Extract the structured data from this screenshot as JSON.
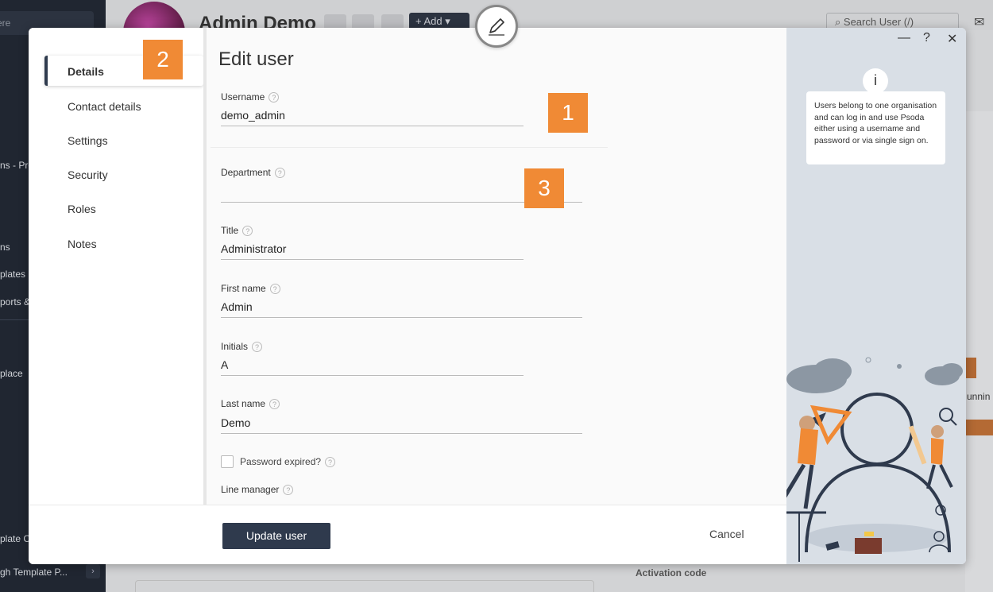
{
  "background": {
    "sidebar": {
      "search_text": "ere",
      "items": [
        {
          "label": "ns - Pro"
        },
        {
          "label": "ns"
        },
        {
          "label": "plates"
        },
        {
          "label": "ports & d"
        },
        {
          "label": "place"
        },
        {
          "label": "plate C"
        },
        {
          "label": "gh Template P..."
        }
      ]
    },
    "header": {
      "title": "Admin Demo",
      "add_label": "Add",
      "search_placeholder": "Search User (/)"
    },
    "right_text": "unnin",
    "activation_label": "Activation code"
  },
  "modal": {
    "title": "Edit user",
    "nav": [
      {
        "label": "Details",
        "active": true
      },
      {
        "label": "Contact details",
        "active": false
      },
      {
        "label": "Settings",
        "active": false
      },
      {
        "label": "Security",
        "active": false
      },
      {
        "label": "Roles",
        "active": false
      },
      {
        "label": "Notes",
        "active": false
      }
    ],
    "fields": {
      "username": {
        "label": "Username",
        "value": "demo_admin"
      },
      "department": {
        "label": "Department",
        "value": ""
      },
      "title": {
        "label": "Title",
        "value": "Administrator"
      },
      "first_name": {
        "label": "First name",
        "value": "Admin"
      },
      "initials": {
        "label": "Initials",
        "value": "A"
      },
      "last_name": {
        "label": "Last name",
        "value": "Demo"
      },
      "password_expired": {
        "label": "Password expired?",
        "checked": false
      },
      "line_manager": {
        "label": "Line manager"
      }
    },
    "help_icon_glyph": "?",
    "footer": {
      "update_label": "Update user",
      "cancel_label": "Cancel"
    },
    "help_panel": {
      "info_glyph": "i",
      "info_text": "Users belong to one organisation and can log in and use Psoda either using a username and password or via single sign on.",
      "controls": {
        "minimize": "—",
        "help": "?",
        "close": "✕"
      }
    }
  },
  "callouts": [
    {
      "number": "1"
    },
    {
      "number": "2"
    },
    {
      "number": "3"
    }
  ],
  "colors": {
    "accent": "#2f3a4d",
    "callout": "#f08a35",
    "help_panel": "#d9dfe6"
  }
}
